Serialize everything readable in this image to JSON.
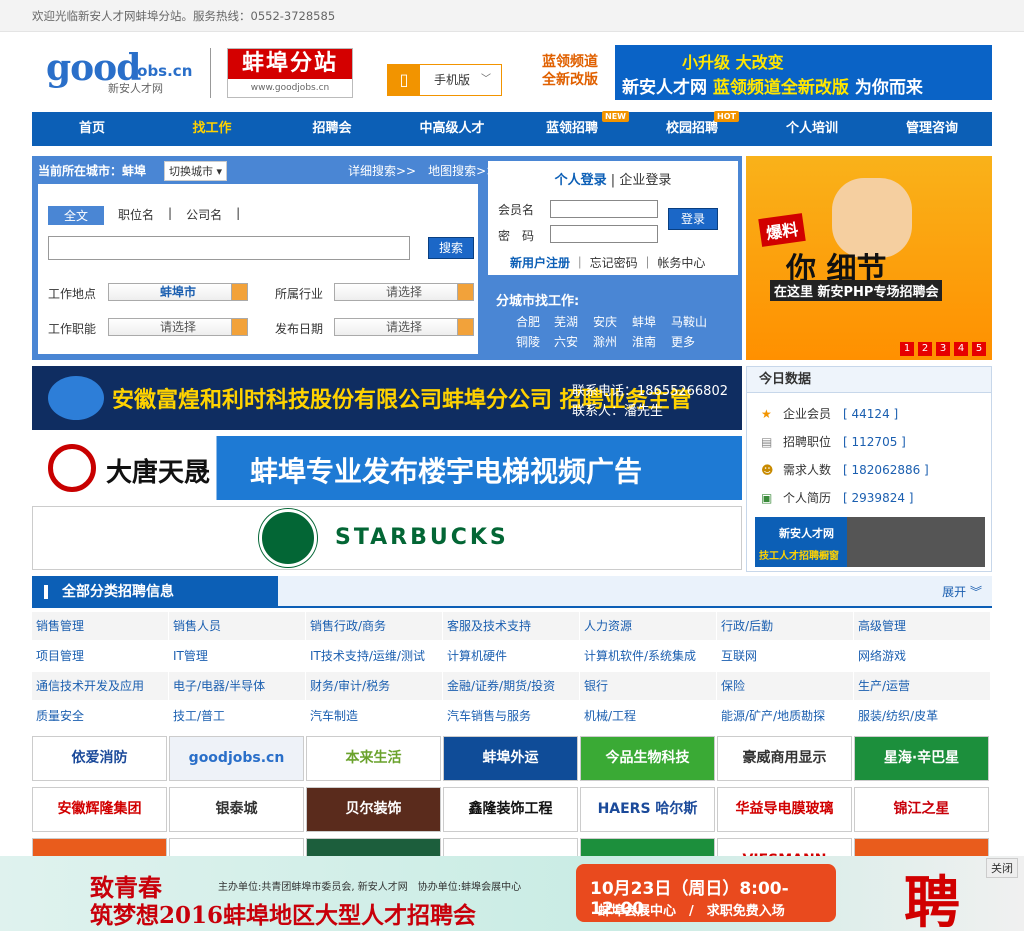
{
  "topbar": {
    "welcome": "欢迎光临新安人才网蚌埠分站。服务热线：0552-3728585"
  },
  "header": {
    "logo_good": "good",
    "logo_jobs": "jobs.cn",
    "logo_sub": "新安人才网",
    "branch_title": "蚌埠分站",
    "branch_url": "www.goodjobs.cn",
    "mobile_label": "手机版",
    "banner_left_1": "蓝领频道",
    "banner_left_2": "全新改版",
    "banner_top": "小升级 大改变",
    "banner_main_a": "新安人才网",
    "banner_main_b": "蓝领频道全新改版",
    "banner_main_c": "为你而来"
  },
  "nav": [
    {
      "label": "首页"
    },
    {
      "label": "找工作"
    },
    {
      "label": "招聘会"
    },
    {
      "label": "中高级人才"
    },
    {
      "label": "蓝领招聘",
      "tag": "NEW"
    },
    {
      "label": "校园招聘",
      "tag": "HOT"
    },
    {
      "label": "个人培训"
    },
    {
      "label": "管理咨询"
    }
  ],
  "search": {
    "current_city": "当前所在城市：蚌埠",
    "switch_city": "切换城市",
    "detail_search": "详细搜索>>",
    "map_search": "地图搜索>>",
    "tabs": [
      "全文",
      "职位名",
      "|",
      "公司名",
      "|"
    ],
    "button": "搜索",
    "location_label": "工作地点",
    "location_value": "蚌埠市",
    "industry_label": "所属行业",
    "industry_value": "请选择",
    "function_label": "工作职能",
    "function_value": "请选择",
    "date_label": "发布日期",
    "date_value": "请选择"
  },
  "login": {
    "personal": "个人登录",
    "sep": "|",
    "company": "企业登录",
    "member_label": "会员名",
    "password_label": "密　码",
    "button": "登录",
    "register": "新用户注册",
    "forgot": "忘记密码",
    "account": "帐务中心"
  },
  "cities": {
    "title": "分城市找工作:",
    "list": [
      "合肥",
      "芜湖",
      "安庆",
      "蚌埠",
      "马鞍山",
      "铜陵",
      "六安",
      "滁州",
      "淮南",
      "更多"
    ]
  },
  "promo": {
    "w1": "爆料",
    "w2": "你 细节",
    "w3": "在这里 新安PHP专场招聘会",
    "pages": [
      "1",
      "2",
      "3",
      "4",
      "5"
    ]
  },
  "ads": {
    "ad1_title": "安徽富煌和利时科技股份有限公司蚌埠分公司 招聘业务主管",
    "ad1_phone": "联系电话：18655266802",
    "ad1_contact": "联系人：潘先生",
    "ad2_brand": "大唐天晟",
    "ad2_title": "蚌埠专业发布楼宇电梯视频广告",
    "ad3_brand": "STARBUCKS"
  },
  "today": {
    "title": "今日数据",
    "items": [
      {
        "label": "企业会员",
        "value": "[ 44124 ]"
      },
      {
        "label": "招聘职位",
        "value": "[ 112705 ]"
      },
      {
        "label": "需求人数",
        "value": "[ 182062886 ]"
      },
      {
        "label": "个人简历",
        "value": "[ 2939824 ]"
      }
    ],
    "img_a": "新安人才网",
    "img_b": "技工人才招聘橱窗"
  },
  "categories": {
    "title": "全部分类招聘信息",
    "expand": "展开",
    "rows": [
      [
        "销售管理",
        "销售人员",
        "销售行政/商务",
        "客服及技术支持",
        "人力资源",
        "行政/后勤",
        "高级管理"
      ],
      [
        "项目管理",
        "IT管理",
        "IT技术支持/运维/测试",
        "计算机硬件",
        "计算机软件/系统集成",
        "互联网",
        "网络游戏"
      ],
      [
        "通信技术开发及应用",
        "电子/电器/半导体",
        "财务/审计/税务",
        "金融/证券/期货/投资",
        "银行",
        "保险",
        "生产/运营"
      ],
      [
        "质量安全",
        "技工/普工",
        "汽车制造",
        "汽车销售与服务",
        "机械/工程",
        "能源/矿产/地质勘探",
        "服装/纺织/皮革"
      ]
    ]
  },
  "logos": [
    [
      {
        "text": "依爱消防",
        "bg": "#ffffff",
        "fg": "#1b4a9a"
      },
      {
        "text": "goodjobs.cn",
        "bg": "#eef2f8",
        "fg": "#2a6fc9"
      },
      {
        "text": "本来生活",
        "bg": "#ffffff",
        "fg": "#6aa22c"
      },
      {
        "text": "蚌埠外运",
        "bg": "#0f4c98",
        "fg": "#ffffff"
      },
      {
        "text": "今品生物科技",
        "bg": "#3aaa35",
        "fg": "#ffffff"
      },
      {
        "text": "豪威商用显示",
        "bg": "#ffffff",
        "fg": "#333333"
      },
      {
        "text": "星海·辛巴星",
        "bg": "#1c8f3c",
        "fg": "#ffffff"
      }
    ],
    [
      {
        "text": "安徽辉隆集团",
        "bg": "#ffffff",
        "fg": "#d10000"
      },
      {
        "text": "银泰城",
        "bg": "#ffffff",
        "fg": "#333333"
      },
      {
        "text": "贝尔装饰",
        "bg": "#5a2b1c",
        "fg": "#ffffff"
      },
      {
        "text": "鑫隆装饰工程",
        "bg": "#ffffff",
        "fg": "#111111"
      },
      {
        "text": "HAERS 哈尔斯",
        "bg": "#ffffff",
        "fg": "#1b4a9a"
      },
      {
        "text": "华益导电膜玻璃",
        "bg": "#ffffff",
        "fg": "#d10000"
      },
      {
        "text": "锦江之星",
        "bg": "#ffffff",
        "fg": "#c8000a"
      }
    ],
    [
      {
        "text": "",
        "bg": "#e95c1c",
        "fg": "#ffffff"
      },
      {
        "text": "",
        "bg": "#ffffff",
        "fg": "#1b4a9a"
      },
      {
        "text": "",
        "bg": "#1c5e3c",
        "fg": "#ffffff"
      },
      {
        "text": "",
        "bg": "#ffffff",
        "fg": "#d10000"
      },
      {
        "text": "",
        "bg": "#1c8f3c",
        "fg": "#ffffff"
      },
      {
        "text": "VIESMANN",
        "bg": "#ffffff",
        "fg": "#d10000"
      },
      {
        "text": "",
        "bg": "#e95c1c",
        "fg": "#ffffff"
      }
    ]
  ],
  "bottom": {
    "line1": "致青春",
    "line2": "筑梦想2016蚌埠地区大型人才招聘会",
    "sponsor": "主办单位:共青团蚌埠市委员会, 新安人才网　协办单位:蚌埠会展中心",
    "date": "10月23日（周日）8:00-12:00",
    "venue": "蚌埠会展中心　/　求职免费入场",
    "hire": "聘",
    "close": "关闭"
  }
}
